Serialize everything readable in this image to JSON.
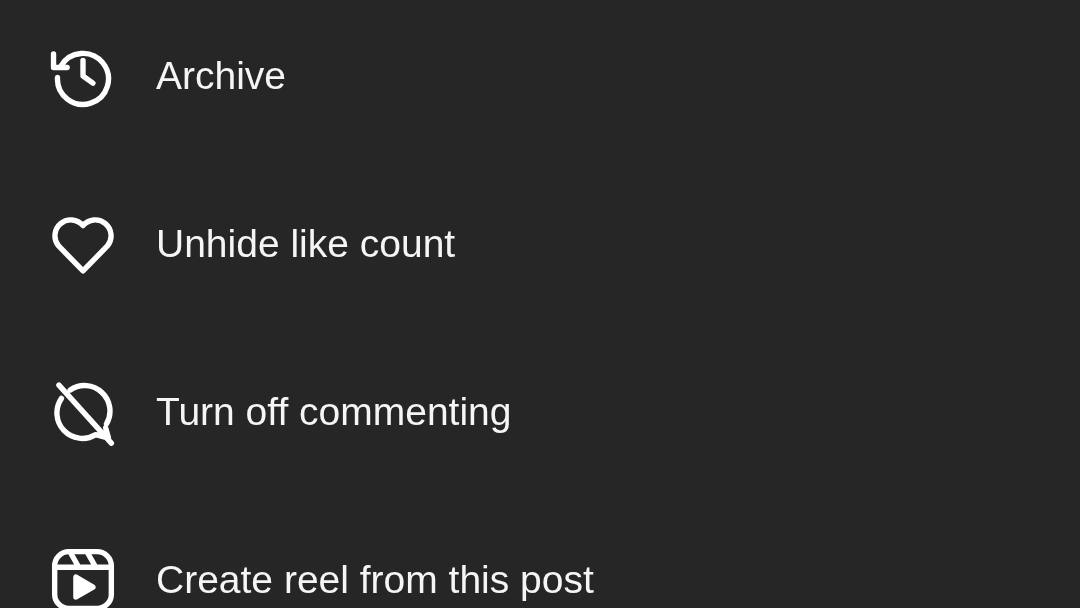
{
  "menu_items": [
    {
      "label": "Archive",
      "kind": "archive"
    },
    {
      "label": "Unhide like count",
      "kind": "like"
    },
    {
      "label": "Turn off commenting",
      "kind": "comment_off"
    },
    {
      "label": "Create reel from this post",
      "kind": "reel"
    }
  ]
}
